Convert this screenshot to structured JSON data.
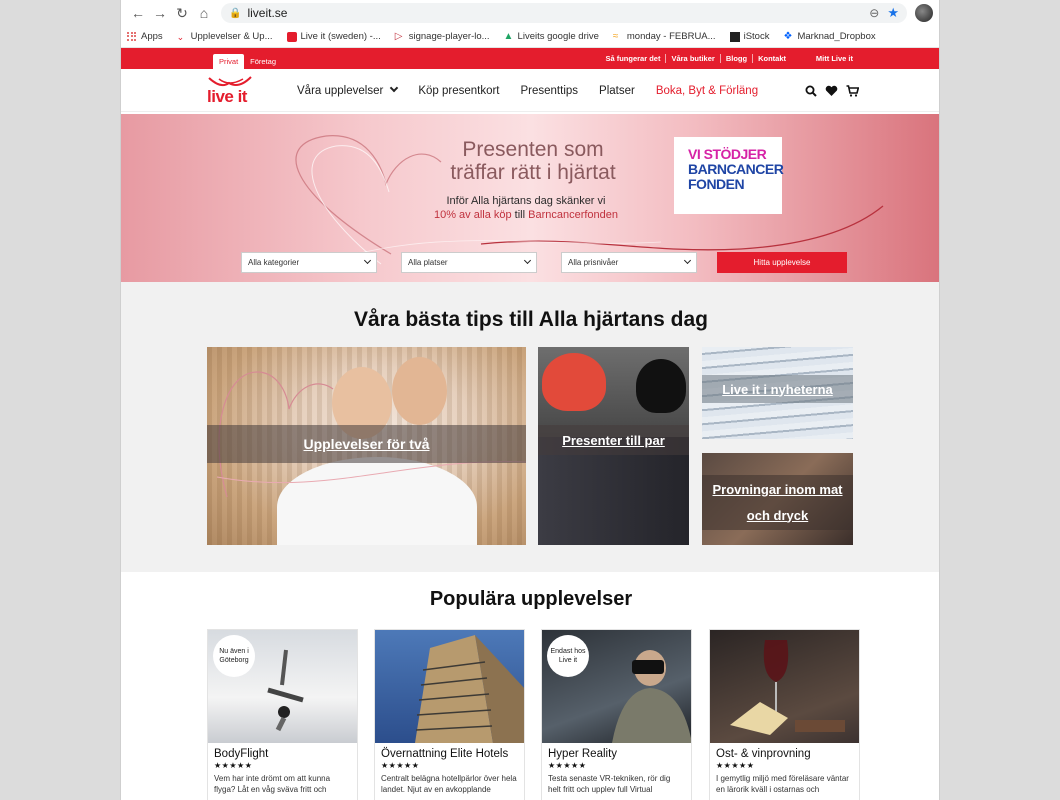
{
  "browser": {
    "url": "liveit.se",
    "bookmarks": [
      "Apps",
      "Upplevelser & Up...",
      "Live it (sweden) -...",
      "signage-player-lo...",
      "Liveits google drive",
      "monday - FEBRUA...",
      "iStock",
      "Marknad_Dropbox"
    ]
  },
  "topbar": {
    "segments": [
      "Privat",
      "Företag"
    ],
    "links": [
      "Så fungerar det",
      "Våra butiker",
      "Blogg",
      "Kontakt"
    ],
    "account": "Mitt Live it"
  },
  "nav": {
    "logo": "live it",
    "items": [
      "Våra upplevelser",
      "Köp presentkort",
      "Presenttips",
      "Platser",
      "Boka, Byt & Förläng"
    ]
  },
  "hero": {
    "title_line1": "Presenten som",
    "title_line2": "träffar rätt i hjärtat",
    "sub_line1": "Inför Alla hjärtans dag skänker vi",
    "sub_red1": "10% av alla köp",
    "sub_mid": " till ",
    "sub_red2": "Barncancerfonden",
    "badge_l1": "VI STÖDJER",
    "badge_l2": "BARNCANCER",
    "badge_l3": "FONDEN",
    "filters": [
      "Alla kategorier",
      "Alla platser",
      "Alla prisnivåer"
    ],
    "cta": "Hitta upplevelse"
  },
  "tips": {
    "heading": "Våra bästa tips till Alla hjärtans dag",
    "tiles": [
      "Upplevelser för två",
      "Presenter till par",
      "Live it i nyheterna",
      "Provningar inom mat och dryck"
    ]
  },
  "popular": {
    "heading": "Populära upplevelser",
    "cards": [
      {
        "tag": "Nu även i Göteborg",
        "name": "BodyFlight",
        "stars": "★★★★★",
        "desc": "Vem har inte drömt om att kunna flyga? Låt en våg sväva fritt och"
      },
      {
        "tag": "",
        "name": "Övernattning Elite Hotels",
        "stars": "★★★★★",
        "desc": "Centralt belägna hotellpärlor över hela landet. Njut av en avkopplande"
      },
      {
        "tag": "Endast hos Live it",
        "name": "Hyper Reality",
        "stars": "★★★★★",
        "desc": "Testa senaste VR-tekniken, rör dig helt fritt och upplev full Virtual"
      },
      {
        "tag": "",
        "name": "Ost- & vinprovning",
        "stars": "★★★★★",
        "desc": "I gemytlig miljö med föreläsare väntar en lärorik kväll i ostarnas och"
      }
    ]
  },
  "colors": {
    "brand": "#e41d2d"
  }
}
